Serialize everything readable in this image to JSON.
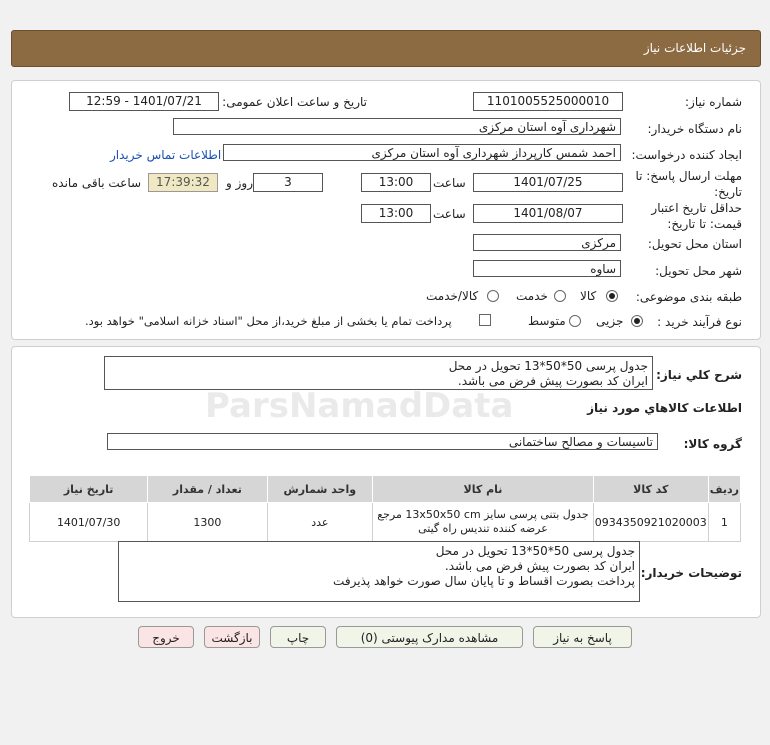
{
  "header": {
    "title": "جزئیات اطلاعات نیاز"
  },
  "form": {
    "need_no_label": "شماره نیاز:",
    "need_no": "1101005525000010",
    "announce_label": "تاریخ و ساعت اعلان عمومی:",
    "announce_value": "1401/07/21 - 12:59",
    "buyer_label": "نام دستگاه خریدار:",
    "buyer_value": "شهرداری آوه استان مرکزی",
    "creator_label": "ایجاد کننده درخواست:",
    "creator_value": "احمد  شمس کارپرداز شهرداری آوه استان مرکزی",
    "contact_link": "اطلاعات تماس خریدار",
    "deadline_label": "مهلت ارسال پاسخ: تا تاریخ:",
    "deadline_date": "1401/07/25",
    "time_label": "ساعت",
    "deadline_time": "13:00",
    "days_value": "3",
    "days_label": "روز و",
    "remaining_time": "17:39:32",
    "remaining_label": "ساعت باقی مانده",
    "validity_label": "حداقل تاریخ اعتبار قیمت: تا تاریخ:",
    "validity_date": "1401/08/07",
    "validity_time": "13:00",
    "province_label": "استان محل تحویل:",
    "province_value": "مرکزی",
    "city_label": "شهر محل تحویل:",
    "city_value": "ساوه",
    "category_label": "طبقه بندی موضوعی:",
    "category_options": [
      "کالا",
      "خدمت",
      "کالا/خدمت"
    ],
    "process_label": "نوع فرآیند خرید :",
    "process_options": [
      "جزیی",
      "متوسط"
    ],
    "payment_note": "پرداخت تمام یا بخشی از مبلغ خرید،از محل \"اسناد خزانه اسلامی\" خواهد بود."
  },
  "summary": {
    "label": "شرح کلي نياز:",
    "line1": "جدول پرسی 50*50*13 تحویل در محل",
    "line2": "ایران کد بصورت پیش فرض می باشد."
  },
  "goods": {
    "section_title": "اطلاعات کالاهاي مورد نياز",
    "group_label": "گروه کالا:",
    "group_value": "تاسیسات و مصالح ساختمانی",
    "columns": [
      "ردیف",
      "کد کالا",
      "نام کالا",
      "واحد شمارش",
      "تعداد / مقدار",
      "تاریخ نیاز"
    ],
    "rows": [
      {
        "row": "1",
        "code": "0934350921020003",
        "name": "جدول بتنی پرسی سایز 13x50x50 cm مرجع عرضه کننده تندیس راه گیتی",
        "unit": "عدد",
        "qty": "1300",
        "date": "1401/07/30"
      }
    ]
  },
  "buyer_notes": {
    "label": "توضیحات خریدار:",
    "line1": "جدول پرسی 50*50*13 تحویل در محل",
    "line2": "ایران کد بصورت پیش فرض می باشد.",
    "line3": "پرداخت بصورت اقساط و تا پایان سال صورت خواهد پذیرفت"
  },
  "buttons": {
    "respond": "پاسخ به نیاز",
    "attachments": "مشاهده مدارک پیوستی (0)",
    "print": "چاپ",
    "back": "بازگشت",
    "exit": "خروج"
  },
  "watermark": {
    "brand": "ParsNamadData"
  },
  "colors": {
    "header": "#8c6a42",
    "link": "#1a4fb5",
    "yellow": "#efe8c2"
  }
}
